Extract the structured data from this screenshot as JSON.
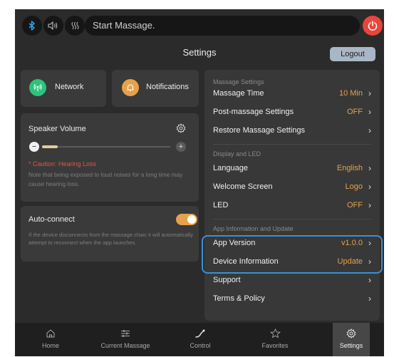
{
  "topbar": {
    "icons": [
      "bluetooth-icon",
      "speaker-icon",
      "heat-icon",
      "power-icon"
    ],
    "status_text": "Start Massage."
  },
  "header": {
    "title": "Settings",
    "logout_label": "Logout"
  },
  "quick": {
    "network_label": "Network",
    "notifications_label": "Notifications"
  },
  "volume": {
    "title": "Speaker Volume",
    "level_fraction": 0.12,
    "minus": "−",
    "plus": "+",
    "caution": "* Caution: Hearing Loss",
    "note": "Note that being exposed to loud noises for a long time may cause hearing loss."
  },
  "autoconnect": {
    "title": "Auto-connect",
    "enabled": true,
    "note": "If the device disconnects from the massage chaic it will automatically attempt to reconnect when the app launches."
  },
  "settings": {
    "massage_section": "Massage Settings",
    "massage_time_label": "Massage Time",
    "massage_time_value": "10 Min",
    "post_massage_label": "Post-massage Settings",
    "post_massage_value": "OFF",
    "restore_label": "Restore Massage Settings",
    "display_section": "Display and LED",
    "language_label": "Language",
    "language_value": "English",
    "welcome_label": "Welcome Screen",
    "welcome_value": "Logo",
    "led_label": "LED",
    "led_value": "OFF",
    "app_section": "App Information and Update",
    "app_version_label": "App Version",
    "app_version_value": "v1.0.0",
    "device_info_label": "Device Information",
    "device_info_value": "Update",
    "support_label": "Support",
    "terms_label": "Terms & Policy",
    "chevron": "›"
  },
  "nav": {
    "home": "Home",
    "current_massage": "Current Massage",
    "control": "Control",
    "favorites": "Favorites",
    "settings": "Settings",
    "active": "settings"
  },
  "colors": {
    "accent": "#e6a24a",
    "power": "#e8453c",
    "highlight": "#3b8fd9",
    "network": "#2bc47a",
    "notifications": "#e6a24a"
  }
}
